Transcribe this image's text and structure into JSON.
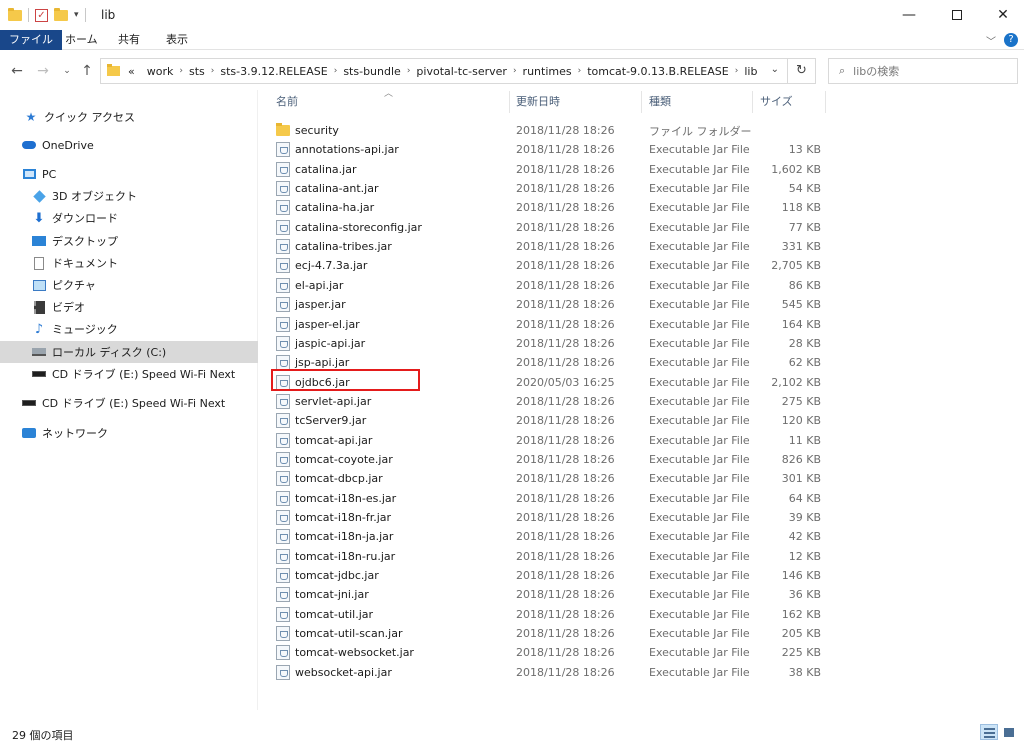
{
  "window": {
    "title": "lib",
    "minimize": "—",
    "close": "✕"
  },
  "ribbon": {
    "tabs": [
      "ファイル",
      "ホーム",
      "共有",
      "表示"
    ],
    "expand_icon": "chevron-down-icon",
    "help": "?"
  },
  "address_bar": {
    "overflow": "«",
    "path": [
      "work",
      "sts",
      "sts-3.9.12.RELEASE",
      "sts-bundle",
      "pivotal-tc-server",
      "runtimes",
      "tomcat-9.0.13.B.RELEASE",
      "lib"
    ],
    "separator": "›"
  },
  "search": {
    "placeholder": "libの検索"
  },
  "sidebar": {
    "items": [
      {
        "label": "クイック アクセス",
        "icon": "star-icon"
      },
      {
        "label": "OneDrive",
        "icon": "cloud-icon"
      },
      {
        "label": "PC",
        "icon": "pc-icon"
      },
      {
        "label": "3D オブジェクト",
        "icon": "3d-objects-icon"
      },
      {
        "label": "ダウンロード",
        "icon": "download-icon"
      },
      {
        "label": "デスクトップ",
        "icon": "desktop-icon"
      },
      {
        "label": "ドキュメント",
        "icon": "document-icon"
      },
      {
        "label": "ピクチャ",
        "icon": "picture-icon"
      },
      {
        "label": "ビデオ",
        "icon": "video-icon"
      },
      {
        "label": "ミュージック",
        "icon": "music-icon"
      },
      {
        "label": "ローカル ディスク (C:)",
        "icon": "drive-icon",
        "selected": true
      },
      {
        "label": "CD ドライブ (E:) Speed Wi-Fi Next",
        "icon": "cd-drive-icon"
      },
      {
        "label": "CD ドライブ (E:) Speed Wi-Fi Next",
        "icon": "cd-drive-icon"
      },
      {
        "label": "ネットワーク",
        "icon": "network-icon"
      }
    ]
  },
  "columns": {
    "name": "名前",
    "date": "更新日時",
    "type": "種類",
    "size": "サイズ"
  },
  "files": [
    {
      "name": "security",
      "date": "2018/11/28 18:26",
      "type": "ファイル フォルダー",
      "size": "",
      "kind": "folder"
    },
    {
      "name": "annotations-api.jar",
      "date": "2018/11/28 18:26",
      "type": "Executable Jar File",
      "size": "13 KB",
      "kind": "jar"
    },
    {
      "name": "catalina.jar",
      "date": "2018/11/28 18:26",
      "type": "Executable Jar File",
      "size": "1,602 KB",
      "kind": "jar"
    },
    {
      "name": "catalina-ant.jar",
      "date": "2018/11/28 18:26",
      "type": "Executable Jar File",
      "size": "54 KB",
      "kind": "jar"
    },
    {
      "name": "catalina-ha.jar",
      "date": "2018/11/28 18:26",
      "type": "Executable Jar File",
      "size": "118 KB",
      "kind": "jar"
    },
    {
      "name": "catalina-storeconfig.jar",
      "date": "2018/11/28 18:26",
      "type": "Executable Jar File",
      "size": "77 KB",
      "kind": "jar"
    },
    {
      "name": "catalina-tribes.jar",
      "date": "2018/11/28 18:26",
      "type": "Executable Jar File",
      "size": "331 KB",
      "kind": "jar"
    },
    {
      "name": "ecj-4.7.3a.jar",
      "date": "2018/11/28 18:26",
      "type": "Executable Jar File",
      "size": "2,705 KB",
      "kind": "jar"
    },
    {
      "name": "el-api.jar",
      "date": "2018/11/28 18:26",
      "type": "Executable Jar File",
      "size": "86 KB",
      "kind": "jar"
    },
    {
      "name": "jasper.jar",
      "date": "2018/11/28 18:26",
      "type": "Executable Jar File",
      "size": "545 KB",
      "kind": "jar"
    },
    {
      "name": "jasper-el.jar",
      "date": "2018/11/28 18:26",
      "type": "Executable Jar File",
      "size": "164 KB",
      "kind": "jar"
    },
    {
      "name": "jaspic-api.jar",
      "date": "2018/11/28 18:26",
      "type": "Executable Jar File",
      "size": "28 KB",
      "kind": "jar"
    },
    {
      "name": "jsp-api.jar",
      "date": "2018/11/28 18:26",
      "type": "Executable Jar File",
      "size": "62 KB",
      "kind": "jar"
    },
    {
      "name": "ojdbc6.jar",
      "date": "2020/05/03 16:25",
      "type": "Executable Jar File",
      "size": "2,102 KB",
      "kind": "jar",
      "highlighted": true
    },
    {
      "name": "servlet-api.jar",
      "date": "2018/11/28 18:26",
      "type": "Executable Jar File",
      "size": "275 KB",
      "kind": "jar"
    },
    {
      "name": "tcServer9.jar",
      "date": "2018/11/28 18:26",
      "type": "Executable Jar File",
      "size": "120 KB",
      "kind": "jar"
    },
    {
      "name": "tomcat-api.jar",
      "date": "2018/11/28 18:26",
      "type": "Executable Jar File",
      "size": "11 KB",
      "kind": "jar"
    },
    {
      "name": "tomcat-coyote.jar",
      "date": "2018/11/28 18:26",
      "type": "Executable Jar File",
      "size": "826 KB",
      "kind": "jar"
    },
    {
      "name": "tomcat-dbcp.jar",
      "date": "2018/11/28 18:26",
      "type": "Executable Jar File",
      "size": "301 KB",
      "kind": "jar"
    },
    {
      "name": "tomcat-i18n-es.jar",
      "date": "2018/11/28 18:26",
      "type": "Executable Jar File",
      "size": "64 KB",
      "kind": "jar"
    },
    {
      "name": "tomcat-i18n-fr.jar",
      "date": "2018/11/28 18:26",
      "type": "Executable Jar File",
      "size": "39 KB",
      "kind": "jar"
    },
    {
      "name": "tomcat-i18n-ja.jar",
      "date": "2018/11/28 18:26",
      "type": "Executable Jar File",
      "size": "42 KB",
      "kind": "jar"
    },
    {
      "name": "tomcat-i18n-ru.jar",
      "date": "2018/11/28 18:26",
      "type": "Executable Jar File",
      "size": "12 KB",
      "kind": "jar"
    },
    {
      "name": "tomcat-jdbc.jar",
      "date": "2018/11/28 18:26",
      "type": "Executable Jar File",
      "size": "146 KB",
      "kind": "jar"
    },
    {
      "name": "tomcat-jni.jar",
      "date": "2018/11/28 18:26",
      "type": "Executable Jar File",
      "size": "36 KB",
      "kind": "jar"
    },
    {
      "name": "tomcat-util.jar",
      "date": "2018/11/28 18:26",
      "type": "Executable Jar File",
      "size": "162 KB",
      "kind": "jar"
    },
    {
      "name": "tomcat-util-scan.jar",
      "date": "2018/11/28 18:26",
      "type": "Executable Jar File",
      "size": "205 KB",
      "kind": "jar"
    },
    {
      "name": "tomcat-websocket.jar",
      "date": "2018/11/28 18:26",
      "type": "Executable Jar File",
      "size": "225 KB",
      "kind": "jar"
    },
    {
      "name": "websocket-api.jar",
      "date": "2018/11/28 18:26",
      "type": "Executable Jar File",
      "size": "38 KB",
      "kind": "jar"
    }
  ],
  "status": {
    "item_count": "29 個の項目"
  },
  "colors": {
    "file_tab": "#19478a",
    "highlight_border": "#e41b1b",
    "selected_nav": "#d9d9d9",
    "header_text": "#4c607a"
  }
}
